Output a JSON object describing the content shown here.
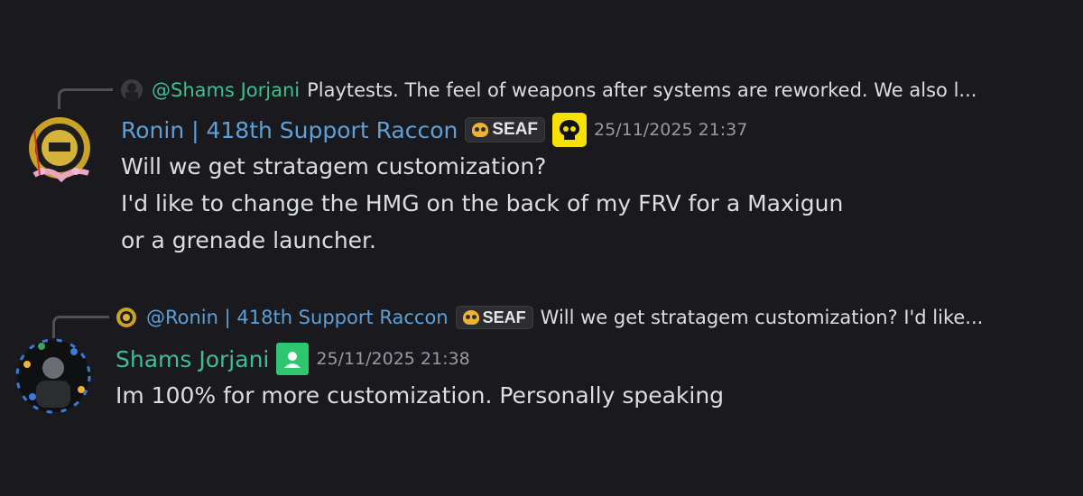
{
  "messages": [
    {
      "reply": {
        "author": "@Shams Jorjani",
        "author_color": "#3fbf8f",
        "preview": "Playtests. The feel of weapons after systems are reworked. We also l..."
      },
      "author": "Ronin | 418th Support Raccon",
      "author_color": "#5da0d8",
      "tag": "SEAF",
      "timestamp": "25/11/2025 21:37",
      "lines": [
        "Will we get stratagem customization?",
        "I'd like to change the HMG on the back of my FRV for a Maxigun",
        "or a grenade launcher."
      ]
    },
    {
      "reply": {
        "author": "@Ronin | 418th Support Raccon",
        "author_color": "#5da0d8",
        "tag": "SEAF",
        "preview": "Will we get stratagem customization? I'd like..."
      },
      "author": "Shams Jorjani",
      "author_color": "#3fbf8f",
      "timestamp": "25/11/2025 21:38",
      "lines": [
        "Im 100% for more customization. Personally speaking"
      ]
    }
  ],
  "icons": {
    "ronin_avatar": "ronin-emblem-avatar",
    "shams_avatar": "shams-avatar",
    "tag_icon": "skull-icon",
    "role_badge": "helldivers-skull-badge",
    "staff_badge": "staff-badge"
  }
}
